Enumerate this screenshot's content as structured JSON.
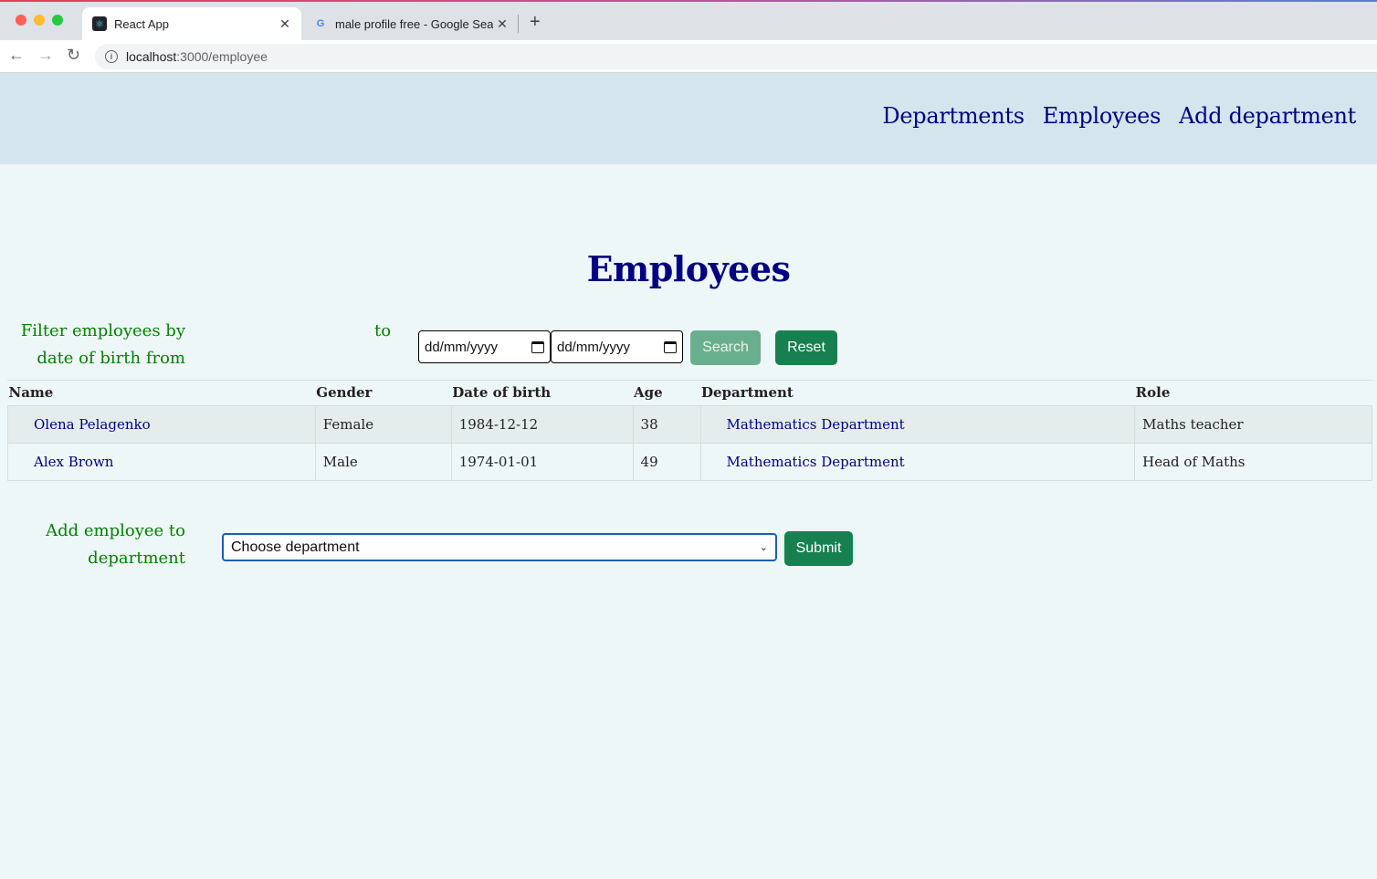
{
  "browser": {
    "tabs": [
      {
        "title": "React App",
        "favicon": "react-icon"
      },
      {
        "title": "male profile free - Google Search",
        "favicon": "google-icon"
      }
    ],
    "url_host": "localhost",
    "url_path": ":3000/employee"
  },
  "nav": {
    "links": [
      "Departments",
      "Employees",
      "Add department"
    ]
  },
  "page": {
    "title": "Employees"
  },
  "filter": {
    "label": "Filter employees by date of birth from",
    "to_label": "to",
    "from_placeholder": "dd/mm/yyyy",
    "to_placeholder": "dd/mm/yyyy",
    "search_label": "Search",
    "reset_label": "Reset"
  },
  "table": {
    "headers": [
      "Name",
      "Gender",
      "Date of birth",
      "Age",
      "Department",
      "Role"
    ],
    "rows": [
      {
        "name": "Olena Pelagenko",
        "gender": "Female",
        "dob": "1984-12-12",
        "age": "38",
        "department": "Mathematics Department",
        "role": "Maths teacher"
      },
      {
        "name": "Alex Brown",
        "gender": "Male",
        "dob": "1974-01-01",
        "age": "49",
        "department": "Mathematics Department",
        "role": "Head of Maths"
      }
    ]
  },
  "add_employee": {
    "label": "Add employee to department",
    "select_value": "Choose department",
    "submit_label": "Submit"
  },
  "colors": {
    "header_bg": "#d4e5ee",
    "page_bg": "#eef7f7",
    "nav_text": "#000080",
    "label_green": "#008000",
    "button_green": "#178050"
  }
}
